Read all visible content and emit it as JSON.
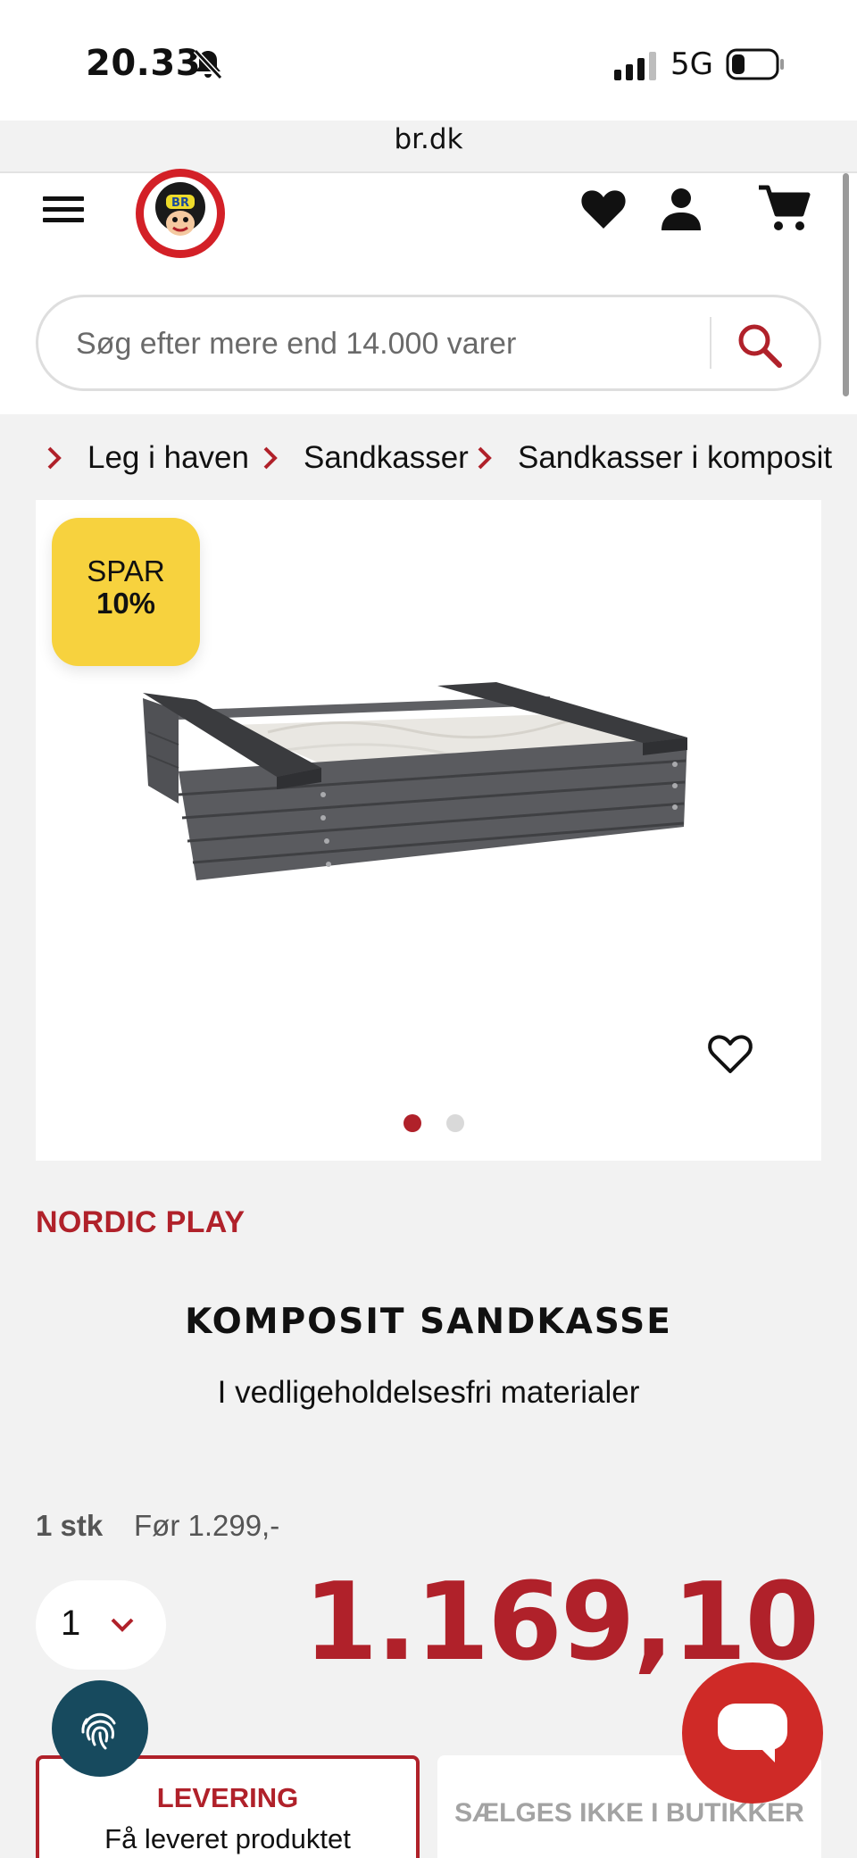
{
  "status_bar": {
    "time": "20.33",
    "network": "5G"
  },
  "browser": {
    "url": "br.dk"
  },
  "header": {
    "logo_text": "BR",
    "icons": [
      "menu-icon",
      "heart-icon",
      "user-icon",
      "cart-icon"
    ]
  },
  "search": {
    "placeholder": "Søg efter mere end 14.000 varer"
  },
  "breadcrumb": [
    {
      "label": "Leg i haven"
    },
    {
      "label": "Sandkasser"
    },
    {
      "label": "Sandkasser i komposit"
    }
  ],
  "gallery": {
    "badge_line1": "SPAR",
    "badge_line2": "10%",
    "active_image": 1,
    "image_count": 2
  },
  "product": {
    "brand": "NORDIC PLAY",
    "title": "KOMPOSIT SANDKASSE",
    "subtitle": "I vedligeholdelsesfri materialer",
    "unit": "1 stk",
    "before_price": "Før 1.299,-",
    "quantity": "1",
    "price": "1.169,10"
  },
  "delivery": {
    "delivery_title": "LEVERING",
    "delivery_text": "Få leveret produktet",
    "store_text": "SÆLGES IKKE I BUTIKKER"
  },
  "colors": {
    "accent": "#b0212a",
    "badge": "#f7d23e",
    "chat": "#cf2a27",
    "fingerprint": "#174a5e"
  }
}
